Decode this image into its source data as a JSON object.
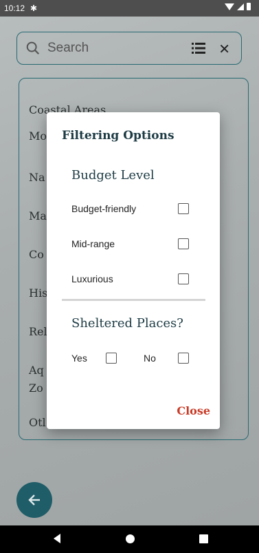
{
  "status_bar": {
    "time": "10:12"
  },
  "search": {
    "placeholder": "Search"
  },
  "background_list": {
    "items": [
      "Coastal Areas",
      "Mo",
      "Na",
      "Ma",
      "Co",
      "His",
      "Rel",
      "Aq",
      "Zo",
      "Otl"
    ]
  },
  "dialog": {
    "title": "Filtering Options",
    "budget": {
      "title": "Budget Level",
      "options": [
        "Budget-friendly",
        "Mid-range",
        "Luxurious"
      ]
    },
    "sheltered": {
      "title": "Sheltered Places?",
      "yes_label": "Yes",
      "no_label": "No"
    },
    "close_label": "Close"
  },
  "colors": {
    "accent": "#1f5d68",
    "close": "#c93a26",
    "title": "#1d3b44"
  }
}
